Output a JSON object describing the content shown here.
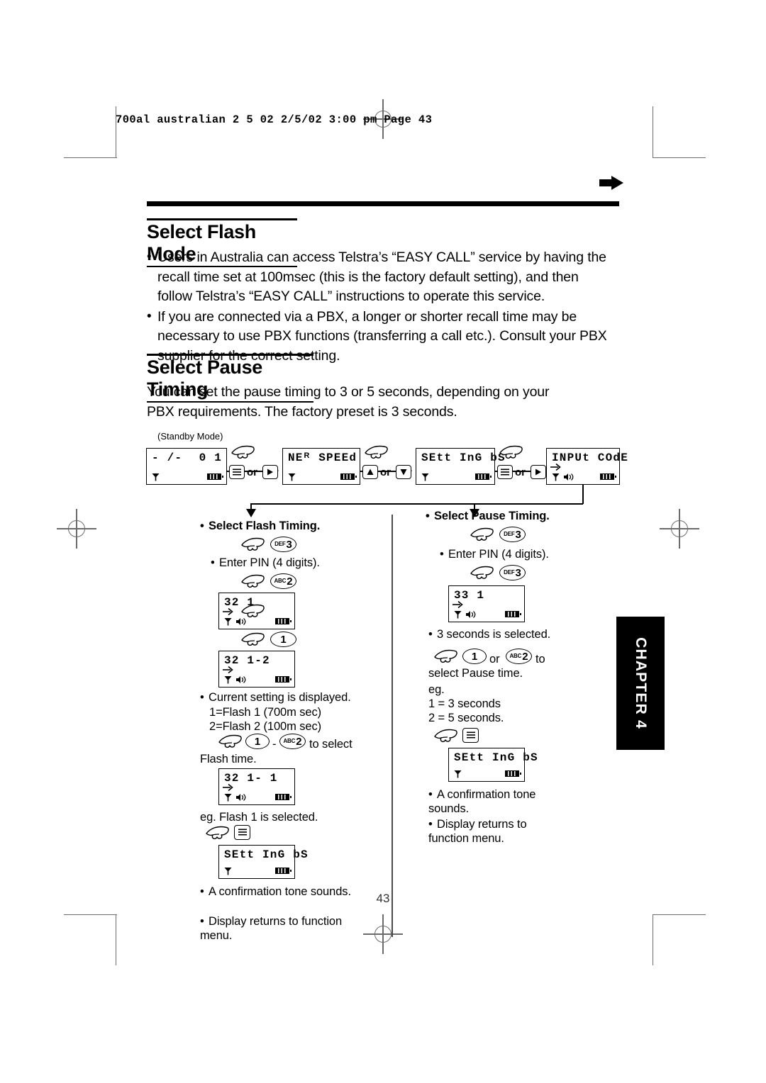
{
  "print_slug": "700al   australian 2 5 02  2/5/02  3:00 pm  Page 43",
  "page_number": "43",
  "chapter_tab": "CHAPTER 4",
  "sections": [
    {
      "heading": "Select Flash Mode",
      "bullets": [
        "Users in Australia can access Telstra’s “EASY CALL” service by having the recall time set at 100msec (this is the factory default setting), and then follow Telstra’s “EASY CALL” instructions to operate this service.",
        "If you are connected via a PBX, a longer or shorter recall time may be necessary to use PBX functions (transferring a call etc.). Consult your PBX supplier for the correct setting."
      ]
    },
    {
      "heading": "Select Pause Timing",
      "paragraph": "You can set the pause timing to 3 or 5 seconds, depending on your PBX requirements. The factory preset is 3 seconds."
    }
  ],
  "flow": {
    "standby_label": "(Standby Mode)",
    "steps": [
      {
        "lcd_left": "- /-",
        "lcd_right": "0 1",
        "keys": "menu-or-right"
      },
      {
        "lcd_main": "NEᴿ SPEEd",
        "keys": "up-or-down"
      },
      {
        "lcd_main": "SEtt InG bS",
        "keys": "menu-or-right"
      },
      {
        "lcd_main": "INPUt COdE",
        "keys": ""
      }
    ],
    "or_label": "or"
  },
  "left_column": {
    "title": "Select Flash Timing.",
    "key1": {
      "prefix": "DEF",
      "num": "3"
    },
    "step_pin": "Enter PIN (4 digits).",
    "key2": {
      "prefix": "ABC",
      "num": "2"
    },
    "lcd1": "32  1",
    "key3": {
      "prefix": "",
      "num": "1"
    },
    "lcd2": "32  1-2",
    "notes1": [
      "Current setting is displayed.",
      "1=Flash 1 (700m sec)",
      "2=Flash 2 (100m sec)"
    ],
    "key4": {
      "prefix": "",
      "num": "1"
    },
    "key_dash": "-",
    "key5": {
      "prefix": "ABC",
      "num": "2"
    },
    "select_text": "to select",
    "select_text2": "Flash time.",
    "lcd3": "32  1- 1",
    "eg_text": "eg. Flash 1 is selected.",
    "lcd4": "SEtt InG bS",
    "notes2": [
      "A confirmation tone sounds.",
      "Display returns to function menu."
    ]
  },
  "right_column": {
    "title": "Select Pause Timing.",
    "key1": {
      "prefix": "DEF",
      "num": "3"
    },
    "step_pin": "Enter PIN (4 digits).",
    "key2": {
      "prefix": "DEF",
      "num": "3"
    },
    "lcd1": "33  1",
    "note_selected": "3 seconds is selected.",
    "key3": {
      "prefix": "",
      "num": "1"
    },
    "or_label": "or",
    "key4": {
      "prefix": "ABC",
      "num": "2"
    },
    "to_label": "to",
    "select_text": "select Pause time.",
    "eg_label": "eg.",
    "eg_lines": [
      "1 = 3 seconds",
      "2 = 5 seconds."
    ],
    "lcd2": "SEtt InG bS",
    "notes2": [
      "A confirmation tone sounds.",
      "Display returns to function menu."
    ]
  }
}
